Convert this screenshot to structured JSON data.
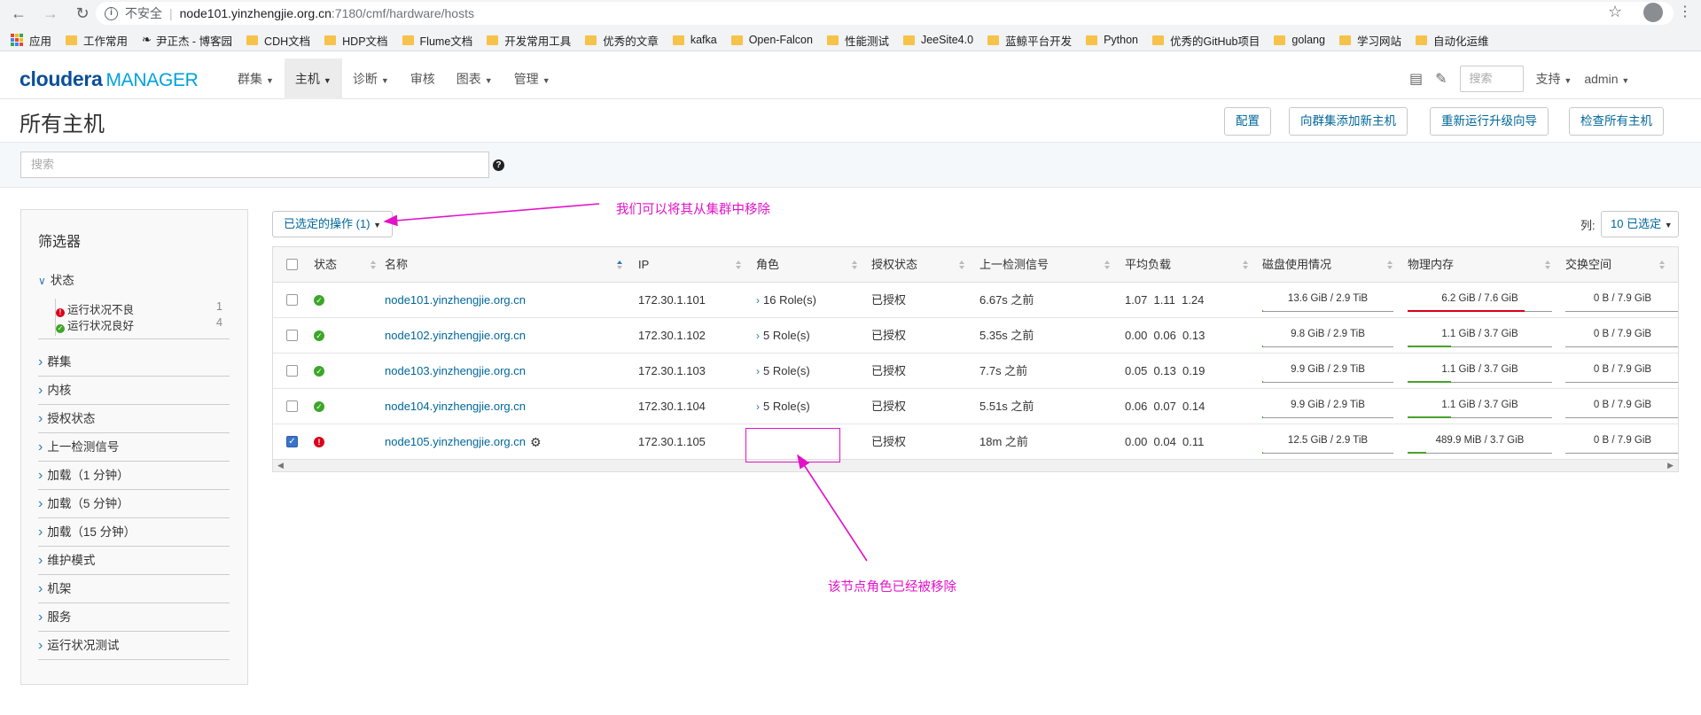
{
  "browser": {
    "security_label": "不安全",
    "url_host": "node101.yinzhengjie.org.cn",
    "url_path": ":7180/cmf/hardware/hosts",
    "bookmarks": [
      "应用",
      "工作常用",
      "尹正杰 - 博客园",
      "CDH文档",
      "HDP文档",
      "Flume文档",
      "开发常用工具",
      "优秀的文章",
      "kafka",
      "Open-Falcon",
      "性能测试",
      "JeeSite4.0",
      "蓝鲸平台开发",
      "Python",
      "优秀的GitHub项目",
      "golang",
      "学习网站",
      "自动化运维"
    ]
  },
  "header": {
    "brand_main": "cloudera",
    "brand_sub": "MANAGER",
    "nav": [
      "群集",
      "主机",
      "诊断",
      "审核",
      "图表",
      "管理"
    ],
    "search_placeholder": "搜索",
    "support": "支持",
    "user": "admin"
  },
  "page": {
    "title": "所有主机",
    "buttons": [
      "配置",
      "向群集添加新主机",
      "重新运行升级向导",
      "检查所有主机"
    ],
    "search_placeholder": "搜索"
  },
  "filters": {
    "title": "筛选器",
    "status_group": "状态",
    "status_items": [
      {
        "label": "运行状况不良",
        "count": "1"
      },
      {
        "label": "运行状况良好",
        "count": "4"
      }
    ],
    "groups": [
      "群集",
      "内核",
      "授权状态",
      "上一检测信号",
      "加载（1 分钟）",
      "加载（5 分钟）",
      "加载（15 分钟）",
      "维护模式",
      "机架",
      "服务",
      "运行状况测试"
    ]
  },
  "actions": {
    "selected_label": "已选定的操作 (1)",
    "columns_label": "列:",
    "columns_selected": "10 已选定"
  },
  "table": {
    "headers": [
      "状态",
      "名称",
      "IP",
      "角色",
      "授权状态",
      "上一检测信号",
      "平均负载",
      "磁盘使用情况",
      "物理内存",
      "交换空间"
    ],
    "rows": [
      {
        "status": "good",
        "checked": false,
        "name": "node101.yinzhengjie.org.cn",
        "ip": "172.30.1.101",
        "roles": "16 Role(s)",
        "auth": "已授权",
        "heartbeat": "6.67s 之前",
        "load": "1.07  1.11  1.24",
        "disk": "13.6 GiB / 2.9 TiB",
        "disk_pct": 0.5,
        "mem": "6.2 GiB / 7.6 GiB",
        "mem_pct": 81,
        "mem_color": "#d9001b",
        "swap": "0 B / 7.9 GiB"
      },
      {
        "status": "good",
        "checked": false,
        "name": "node102.yinzhengjie.org.cn",
        "ip": "172.30.1.102",
        "roles": "5 Role(s)",
        "auth": "已授权",
        "heartbeat": "5.35s 之前",
        "load": "0.00  0.06  0.13",
        "disk": "9.8 GiB / 2.9 TiB",
        "disk_pct": 0.3,
        "mem": "1.1 GiB / 3.7 GiB",
        "mem_pct": 30,
        "mem_color": "#4aa02c",
        "swap": "0 B / 7.9 GiB"
      },
      {
        "status": "good",
        "checked": false,
        "name": "node103.yinzhengjie.org.cn",
        "ip": "172.30.1.103",
        "roles": "5 Role(s)",
        "auth": "已授权",
        "heartbeat": "7.7s 之前",
        "load": "0.05  0.13  0.19",
        "disk": "9.9 GiB / 2.9 TiB",
        "disk_pct": 0.3,
        "mem": "1.1 GiB / 3.7 GiB",
        "mem_pct": 30,
        "mem_color": "#4aa02c",
        "swap": "0 B / 7.9 GiB"
      },
      {
        "status": "good",
        "checked": false,
        "name": "node104.yinzhengjie.org.cn",
        "ip": "172.30.1.104",
        "roles": "5 Role(s)",
        "auth": "已授权",
        "heartbeat": "5.51s 之前",
        "load": "0.06  0.07  0.14",
        "disk": "9.9 GiB / 2.9 TiB",
        "disk_pct": 0.3,
        "mem": "1.1 GiB / 3.7 GiB",
        "mem_pct": 30,
        "mem_color": "#4aa02c",
        "swap": "0 B / 7.9 GiB"
      },
      {
        "status": "bad",
        "checked": true,
        "name": "node105.yinzhengjie.org.cn",
        "ip": "172.30.1.105",
        "roles": "",
        "auth": "已授权",
        "heartbeat": "18m 之前",
        "load": "0.00  0.04  0.11",
        "disk": "12.5 GiB / 2.9 TiB",
        "disk_pct": 0.4,
        "mem": "489.9 MiB / 3.7 GiB",
        "mem_pct": 13,
        "mem_color": "#4aa02c",
        "swap": "0 B / 7.9 GiB"
      }
    ]
  },
  "annotations": {
    "remove_note": "我们可以将其从集群中移除",
    "roles_note": "该节点角色已经被移除",
    "color": "#e312c9"
  }
}
